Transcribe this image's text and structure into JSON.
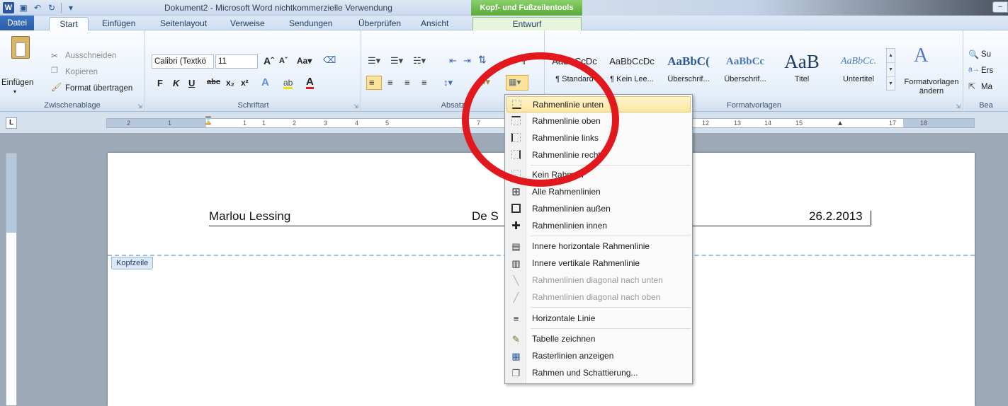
{
  "window": {
    "title": "Dokument2  -  Microsoft Word nichtkommerzielle Verwendung",
    "context_tab": "Kopf- und Fußzeilentools"
  },
  "tabs": [
    "Datei",
    "Start",
    "Einfügen",
    "Seitenlayout",
    "Verweise",
    "Sendungen",
    "Überprüfen",
    "Ansicht",
    "Entwurf"
  ],
  "ribbon": {
    "clipboard": {
      "paste": "Einfügen",
      "cut": "Ausschneiden",
      "copy": "Kopieren",
      "format_painter": "Format übertragen",
      "label": "Zwischenablage"
    },
    "font": {
      "name": "Calibri (Textkö",
      "size": "11",
      "label": "Schriftart",
      "bold": "F",
      "italic": "K",
      "underline": "U"
    },
    "paragraph": {
      "label": "Absatz"
    },
    "styles": {
      "label": "Formatvorlagen",
      "items": [
        {
          "sample": "AaBbCcDc",
          "name": "¶ Standard"
        },
        {
          "sample": "AaBbCcDc",
          "name": "¶ Kein Lee..."
        },
        {
          "sample": "AaBbC(",
          "name": "Überschrif..."
        },
        {
          "sample": "AaBbCc",
          "name": "Überschrif..."
        },
        {
          "sample": "AaB",
          "name": "Titel"
        },
        {
          "sample": "AaBbCc.",
          "name": "Untertitel"
        }
      ],
      "change": "Formatvorlagen ändern"
    },
    "editing": {
      "find": "Su",
      "replace": "Ers",
      "select": "Ma",
      "label": "Bea"
    }
  },
  "ruler": {
    "corner": "L",
    "numbers": [
      "2",
      "1",
      "1",
      "1",
      "2",
      "3",
      "4",
      "5",
      "6",
      "7",
      "12",
      "13",
      "14",
      "15",
      "17",
      "18"
    ]
  },
  "document": {
    "header_left": "Marlou Lessing",
    "header_center": "De S",
    "header_right": "26.2.2013",
    "header_tag": "Kopfzeile"
  },
  "border_menu": {
    "items": [
      {
        "label": "Rahmenlinie unten",
        "icon": "border-bottom-icon",
        "highlighted": true,
        "enabled": true
      },
      {
        "label": "Rahmenlinie oben",
        "icon": "border-top-icon",
        "enabled": true
      },
      {
        "label": "Rahmenlinie links",
        "icon": "border-left-icon",
        "enabled": true
      },
      {
        "label": "Rahmenlinie rechts",
        "icon": "border-right-icon",
        "enabled": true
      },
      {
        "label": "Kein Rahmen",
        "icon": "no-border-icon",
        "enabled": true
      },
      {
        "label": "Alle Rahmenlinien",
        "icon": "all-borders-icon",
        "enabled": true
      },
      {
        "label": "Rahmenlinien außen",
        "icon": "outside-borders-icon",
        "enabled": true
      },
      {
        "label": "Rahmenlinien innen",
        "icon": "inside-borders-icon",
        "enabled": true
      },
      {
        "label": "Innere horizontale Rahmenlinie",
        "icon": "inside-horizontal-border-icon",
        "enabled": true
      },
      {
        "label": "Innere vertikale Rahmenlinie",
        "icon": "inside-vertical-border-icon",
        "enabled": true
      },
      {
        "label": "Rahmenlinien diagonal nach unten",
        "icon": "diagonal-down-border-icon",
        "enabled": false
      },
      {
        "label": "Rahmenlinien diagonal nach oben",
        "icon": "diagonal-up-border-icon",
        "enabled": false
      },
      {
        "label": "Horizontale Linie",
        "icon": "horizontal-line-icon",
        "enabled": true
      },
      {
        "label": "Tabelle zeichnen",
        "icon": "draw-table-icon",
        "enabled": true
      },
      {
        "label": "Rasterlinien anzeigen",
        "icon": "gridlines-icon",
        "enabled": true
      },
      {
        "label": "Rahmen und Schattierung...",
        "icon": "borders-shading-icon",
        "enabled": true
      }
    ]
  },
  "colors": {
    "annotation": "#e1191e",
    "file_tab": "#2a5ca8",
    "context_tab": "#5aa93a",
    "menu_highlight": "#fde6a0"
  }
}
